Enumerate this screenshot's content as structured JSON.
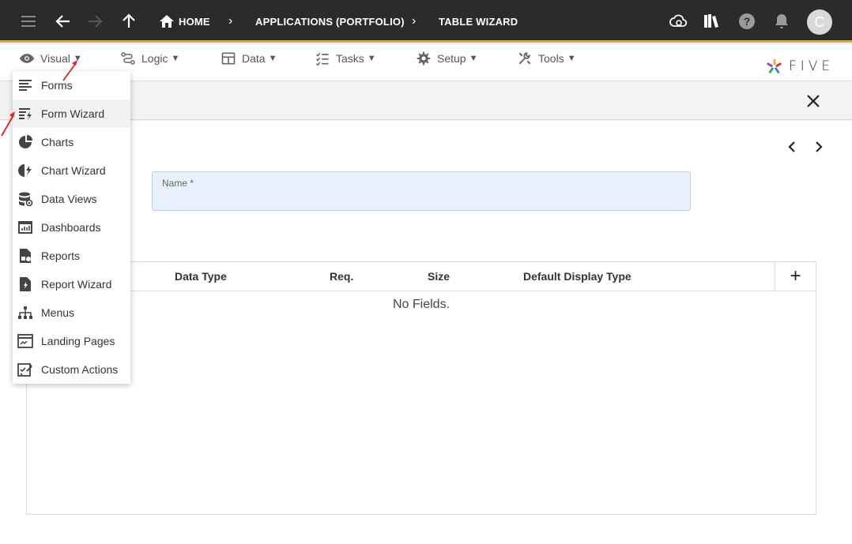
{
  "breadcrumbs": {
    "home": "HOME",
    "applications": "APPLICATIONS (PORTFOLIO)",
    "current": "TABLE WIZARD"
  },
  "user": {
    "initial": "C"
  },
  "menubar": {
    "visual": "Visual",
    "logic": "Logic",
    "data": "Data",
    "tasks": "Tasks",
    "setup": "Setup",
    "tools": "Tools"
  },
  "logo": {
    "text": "FIVE"
  },
  "form": {
    "name_label": "Name *",
    "name_value": ""
  },
  "grid": {
    "columns": [
      "Data Type",
      "Req.",
      "Size",
      "Default Display Type"
    ],
    "add_label": "+",
    "empty_text": "No Fields."
  },
  "visual_menu": {
    "items": [
      {
        "label": "Forms",
        "icon": "forms-icon"
      },
      {
        "label": "Form Wizard",
        "icon": "form-wizard-icon"
      },
      {
        "label": "Charts",
        "icon": "charts-icon"
      },
      {
        "label": "Chart Wizard",
        "icon": "chart-wizard-icon"
      },
      {
        "label": "Data Views",
        "icon": "data-views-icon"
      },
      {
        "label": "Dashboards",
        "icon": "dashboards-icon"
      },
      {
        "label": "Reports",
        "icon": "reports-icon"
      },
      {
        "label": "Report Wizard",
        "icon": "report-wizard-icon"
      },
      {
        "label": "Menus",
        "icon": "menus-icon"
      },
      {
        "label": "Landing Pages",
        "icon": "landing-pages-icon"
      },
      {
        "label": "Custom Actions",
        "icon": "custom-actions-icon"
      }
    ]
  },
  "colors": {
    "topbar": "#2b2b2b",
    "accent": "#f5a623",
    "field_bg": "#e8f1fb",
    "annotation_arrow": "#e02020"
  }
}
